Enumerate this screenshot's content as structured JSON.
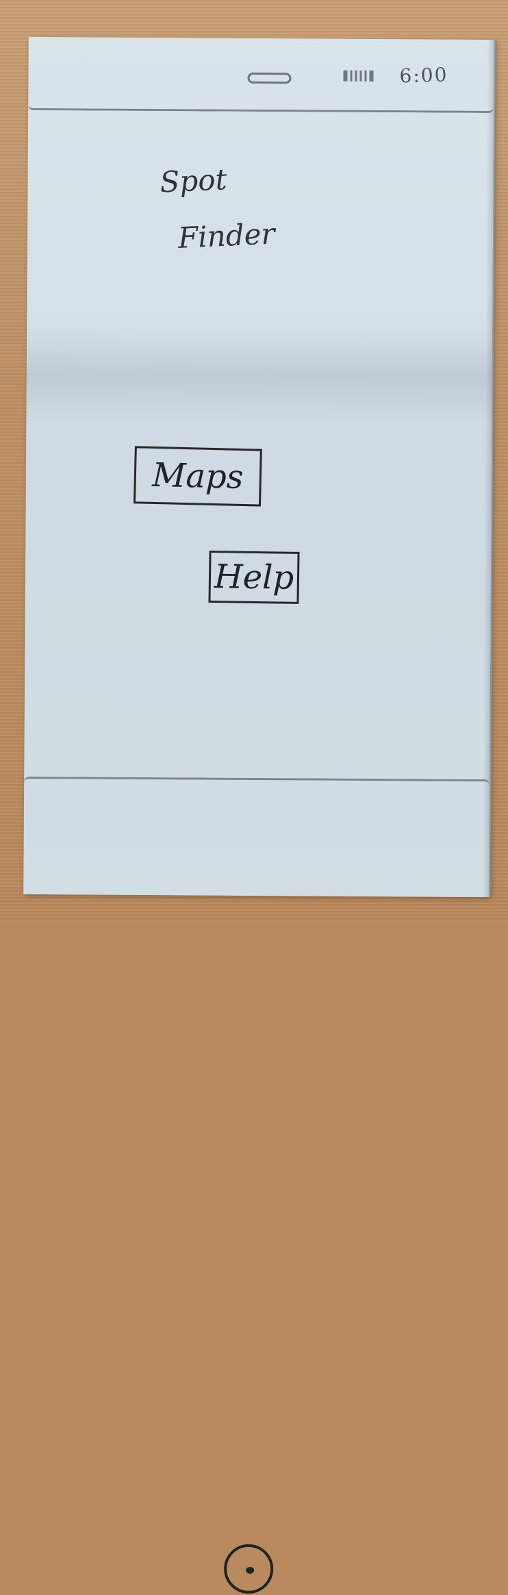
{
  "status_bar": {
    "time": "6:00"
  },
  "app": {
    "title_line_1": "Spot",
    "title_line_2": "Finder"
  },
  "buttons": {
    "maps_label": "Maps",
    "help_label": "Help"
  },
  "colors": {
    "paper": "#d5dfe7",
    "ink": "#1f2326",
    "table": "#bc8d62"
  },
  "icons": {
    "battery": "battery-icon",
    "home": "home-button-icon"
  }
}
